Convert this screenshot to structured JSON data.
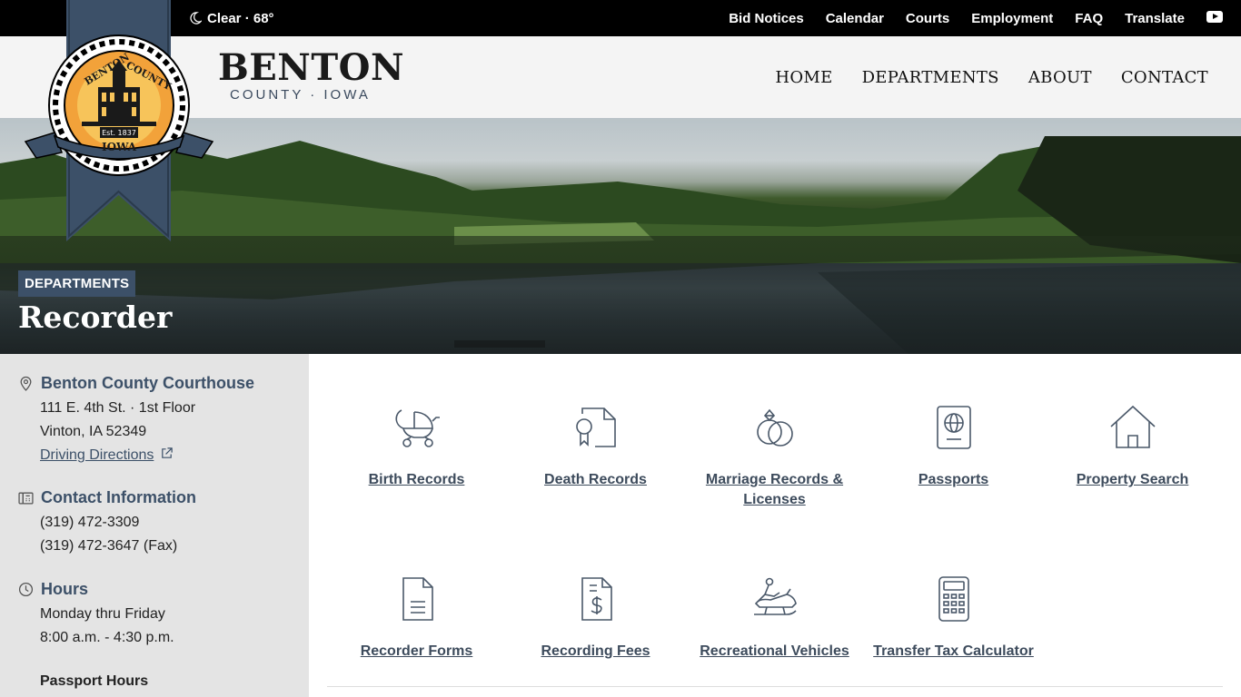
{
  "topbar": {
    "weather": "Clear · 68°",
    "links": [
      "Bid Notices",
      "Calendar",
      "Courts",
      "Employment",
      "FAQ",
      "Translate"
    ],
    "youtube_icon": "youtube-icon"
  },
  "header": {
    "brand_name": "BENTON",
    "brand_sub": "COUNTY · IOWA",
    "seal": {
      "top": "BENTON",
      "top2": "COUNTY",
      "est": "Est. 1837",
      "state": "IOWA"
    },
    "nav": [
      "HOME",
      "DEPARTMENTS",
      "ABOUT",
      "CONTACT"
    ]
  },
  "hero": {
    "badge": "DEPARTMENTS",
    "title": "Recorder"
  },
  "sidebar": {
    "location": {
      "heading": "Benton County Courthouse",
      "address1": "111 E. 4th St. · 1st Floor",
      "address2": "Vinton, IA 52349",
      "directions": "Driving Directions"
    },
    "contact": {
      "heading": "Contact Information",
      "phone": "(319) 472-3309",
      "fax": "(319) 472-3647 (Fax)"
    },
    "hours": {
      "heading": "Hours",
      "days": "Monday thru Friday",
      "times": "8:00 a.m. - 4:30 p.m.",
      "passport_heading": "Passport Hours"
    }
  },
  "tiles": [
    {
      "label": "Birth Records",
      "icon": "baby-carriage-icon"
    },
    {
      "label": "Death Records",
      "icon": "certificate-icon"
    },
    {
      "label": "Marriage Records & Licenses",
      "icon": "rings-icon"
    },
    {
      "label": "Passports",
      "icon": "passport-icon"
    },
    {
      "label": "Property Search",
      "icon": "house-icon"
    },
    {
      "label": "Recorder Forms",
      "icon": "document-icon"
    },
    {
      "label": "Recording Fees",
      "icon": "fee-document-icon"
    },
    {
      "label": "Recreational Vehicles",
      "icon": "snowmobile-icon"
    },
    {
      "label": "Transfer Tax Calculator",
      "icon": "calculator-icon"
    }
  ]
}
